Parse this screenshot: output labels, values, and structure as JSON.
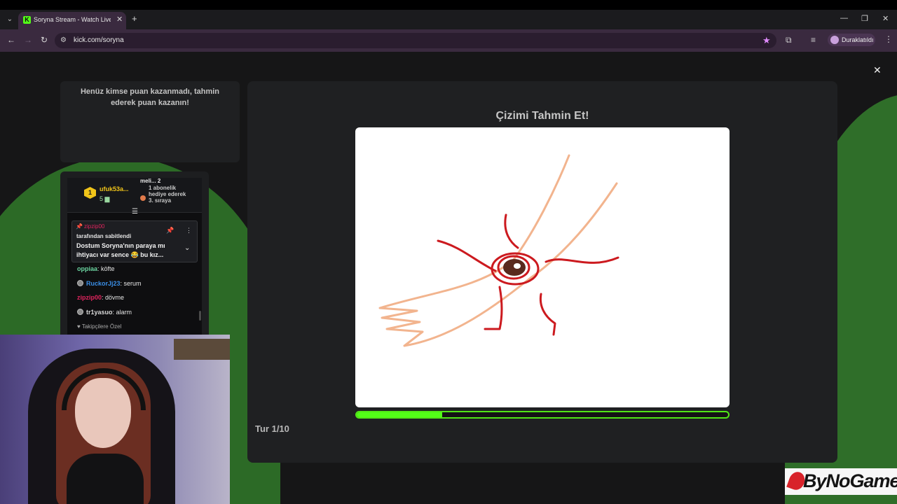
{
  "browser": {
    "tab_title": "Soryna Stream - Watch Live on",
    "tab_favicon_letter": "K",
    "url": "kick.com/soryna",
    "profile_label": "Duraklatıldı"
  },
  "scoreboard": {
    "empty_text": "Henüz kimse puan kazanmadı, tahmin ederek puan kazanın!"
  },
  "chat": {
    "leader": {
      "rank": "1",
      "name": "ufuk53a...",
      "count": "5"
    },
    "gift_top": "meli... 2",
    "gift_text": "1 abonelik hediye ederek 3. sıraya",
    "pinned": {
      "user": "zipzip00",
      "by_text": "tarafından sabitlendi",
      "message": "Dostum Soryna'nın paraya mı ihtiyacı var sence 😂 bu kız..."
    },
    "messages": [
      {
        "user": "oppiaa",
        "text": ": köfte",
        "color": "#6bd4a0",
        "badge": false
      },
      {
        "user": "RuckorJj23",
        "text": ": serum",
        "color": "#3a8ee6",
        "badge": true
      },
      {
        "user": "zipzip00",
        "text": ": dövme",
        "color": "#e0245e",
        "badge": false
      },
      {
        "user": "tr1yasuo",
        "text": ": alarm",
        "color": "#d8d8d8",
        "badge": true
      }
    ],
    "footer_mode": "Takipçilere Özel"
  },
  "game": {
    "title": "Çizimi Tahmin Et!",
    "round_label": "Tur 1/10",
    "timer_progress": 0.23,
    "accent_color": "#53fc18"
  },
  "watermark": {
    "text": "ByNoGame"
  }
}
